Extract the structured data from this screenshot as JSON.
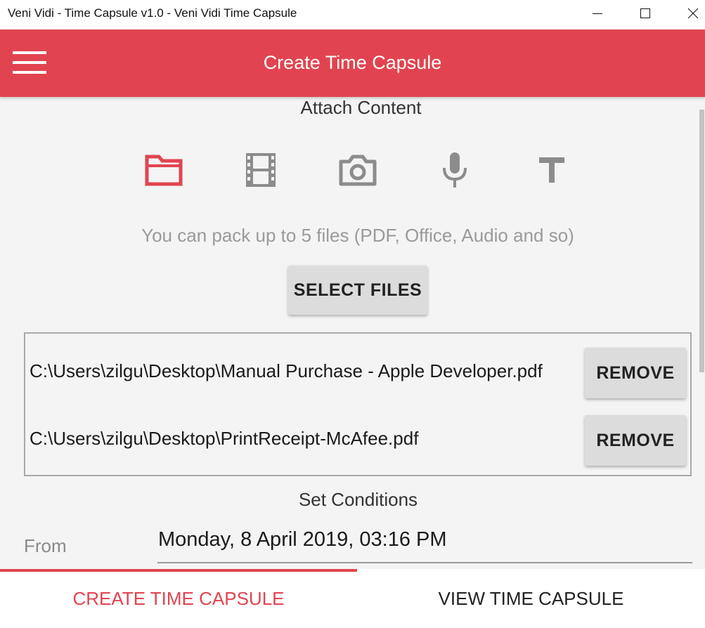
{
  "window": {
    "title": "Veni Vidi - Time Capsule v1.0 - Veni Vidi Time Capsule",
    "controls": [
      "minimize-icon",
      "maximize-icon",
      "close-icon"
    ]
  },
  "appbar": {
    "title": "Create Time Capsule",
    "menu_icon": "hamburger-menu-icon",
    "color": "#e14450"
  },
  "attach": {
    "title": "Attach Content",
    "icons": [
      {
        "name": "folder-icon",
        "selected": true
      },
      {
        "name": "film-icon",
        "selected": false
      },
      {
        "name": "camera-icon",
        "selected": false
      },
      {
        "name": "microphone-icon",
        "selected": false
      },
      {
        "name": "text-icon",
        "selected": false
      }
    ],
    "hint": "You can pack up to 5 files (PDF, Office, Audio and so)",
    "select_button": "SELECT FILES"
  },
  "files": [
    {
      "path": "C:\\Users\\zilgu\\Desktop\\Manual Purchase - Apple Developer.pdf",
      "remove_label": "REMOVE"
    },
    {
      "path": "C:\\Users\\zilgu\\Desktop\\PrintReceipt-McAfee.pdf",
      "remove_label": "REMOVE"
    }
  ],
  "conditions": {
    "title": "Set Conditions",
    "from_label": "From",
    "from_value": "Monday, 8 April 2019, 03:16 PM"
  },
  "tabs": [
    {
      "label": "CREATE TIME CAPSULE",
      "active": true
    },
    {
      "label": "VIEW TIME CAPSULE",
      "active": false
    }
  ],
  "colors": {
    "accent": "#e14450",
    "icon_inactive": "#8c8c8c",
    "background": "#f4f4f4"
  }
}
